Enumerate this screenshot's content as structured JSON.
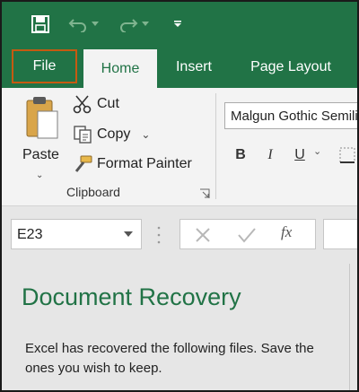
{
  "quick_access": {
    "save_icon": "save-icon",
    "undo_icon": "undo-icon",
    "redo_icon": "redo-icon",
    "customize_icon": "customize-qat-icon"
  },
  "tabs": [
    {
      "label": "File"
    },
    {
      "label": "Home"
    },
    {
      "label": "Insert"
    },
    {
      "label": "Page Layout"
    }
  ],
  "clipboard": {
    "paste_label": "Paste",
    "cut_label": "Cut",
    "copy_label": "Copy",
    "format_painter_label": "Format Painter",
    "group_label": "Clipboard"
  },
  "font": {
    "font_name": "Malgun Gothic Semilight",
    "bold_label": "B",
    "italic_label": "I",
    "underline_label": "U"
  },
  "formula_bar": {
    "name_box_value": "E23",
    "insert_function_label": "fx"
  },
  "recovery": {
    "title": "Document Recovery",
    "message": "Excel has recovered the following files.  Save the ones you wish to keep."
  },
  "colors": {
    "accent": "#217346",
    "file_highlight": "#c55a11"
  }
}
